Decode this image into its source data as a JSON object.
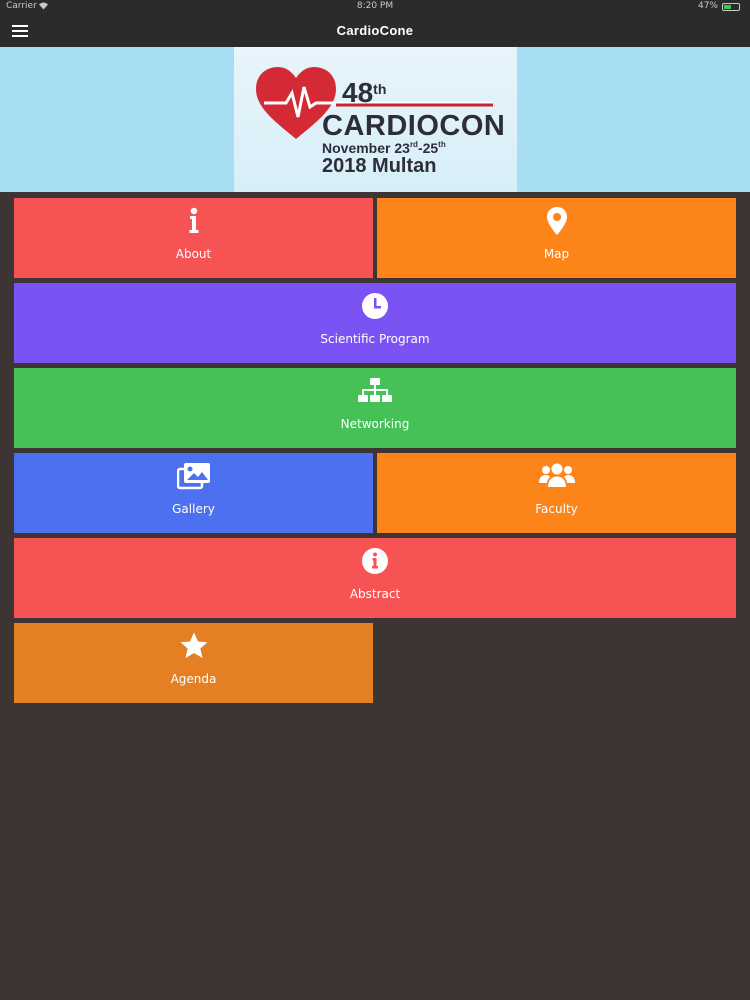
{
  "status": {
    "carrier": "Carrier",
    "time": "8:20 PM",
    "battery": "47%",
    "battery_level": 0.47
  },
  "nav": {
    "title": "CardioCone"
  },
  "banner": {
    "number": "48",
    "number_suffix": "th",
    "name": "CARDIOCON",
    "dates_prefix": "November 23",
    "dates_sup1": "rd",
    "dates_mid": "-25",
    "dates_sup2": "th",
    "place": "2018 Multan"
  },
  "tiles": [
    {
      "label": "About",
      "icon": "info-icon",
      "color": "#f65454"
    },
    {
      "label": "Map",
      "icon": "map-marker-icon",
      "color": "#fd8419"
    },
    {
      "label": "Scientific Program",
      "icon": "clock-icon",
      "color": "#7b53f4"
    },
    {
      "label": "Networking",
      "icon": "sitemap-icon",
      "color": "#45c158"
    },
    {
      "label": "Gallery",
      "icon": "images-icon",
      "color": "#4c70ef"
    },
    {
      "label": "Faculty",
      "icon": "users-icon",
      "color": "#fd8419"
    },
    {
      "label": "Abstract",
      "icon": "info-circle-icon",
      "color": "#f65454"
    },
    {
      "label": "Agenda",
      "icon": "star-icon",
      "color": "#e57f24"
    }
  ],
  "colors": {
    "background": "#3d3533",
    "nav_bar": "#2b2b2b",
    "banner": "#a7def3",
    "heart": "#d42a35"
  }
}
